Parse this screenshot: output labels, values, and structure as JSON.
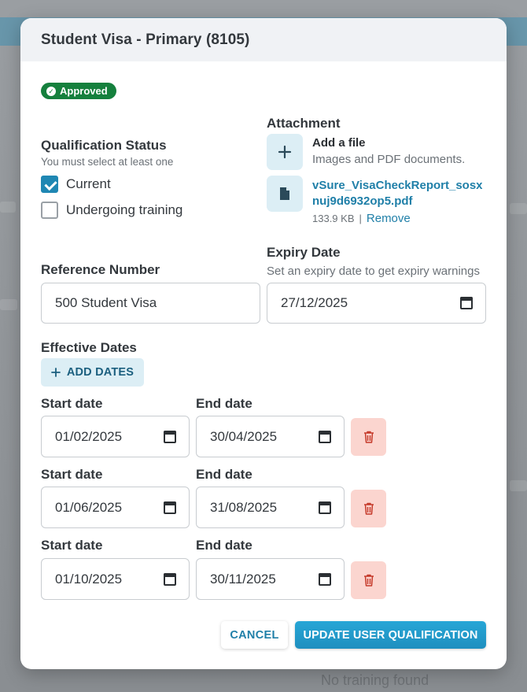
{
  "background": {
    "footer_text": "No training found"
  },
  "modal": {
    "title": "Student Visa - Primary (8105)",
    "status_badge": "Approved",
    "qualification_status": {
      "label": "Qualification Status",
      "hint": "You must select at least one",
      "options": [
        {
          "label": "Current",
          "checked": true
        },
        {
          "label": "Undergoing training",
          "checked": false
        }
      ]
    },
    "attachment": {
      "label": "Attachment",
      "add_title": "Add a file",
      "add_hint": "Images and PDF documents.",
      "file_name": "vSure_VisaCheckReport_sosxnuj9d6932op5.pdf",
      "file_size": "133.9 KB",
      "separator": "|",
      "remove_label": "Remove"
    },
    "reference_number": {
      "label": "Reference Number",
      "value": "500 Student Visa"
    },
    "expiry_date": {
      "label": "Expiry Date",
      "hint": "Set an expiry date to get expiry warnings",
      "value": "27/12/2025"
    },
    "effective_dates": {
      "label": "Effective Dates",
      "add_button": "ADD DATES",
      "start_label": "Start date",
      "end_label": "End date",
      "ranges": [
        {
          "start": "01/02/2025",
          "end": "30/04/2025"
        },
        {
          "start": "01/06/2025",
          "end": "31/08/2025"
        },
        {
          "start": "01/10/2025",
          "end": "30/11/2025"
        }
      ]
    },
    "footer": {
      "cancel": "CANCEL",
      "update": "UPDATE USER QUALIFICATION"
    }
  },
  "colors": {
    "accent": "#1f87b3",
    "approved": "#15803d",
    "danger_bg": "#fbd5cf",
    "danger": "#c53a2a"
  },
  "icons": [
    "check-circle-icon",
    "plus-icon",
    "file-icon",
    "calendar-icon",
    "trash-icon"
  ]
}
